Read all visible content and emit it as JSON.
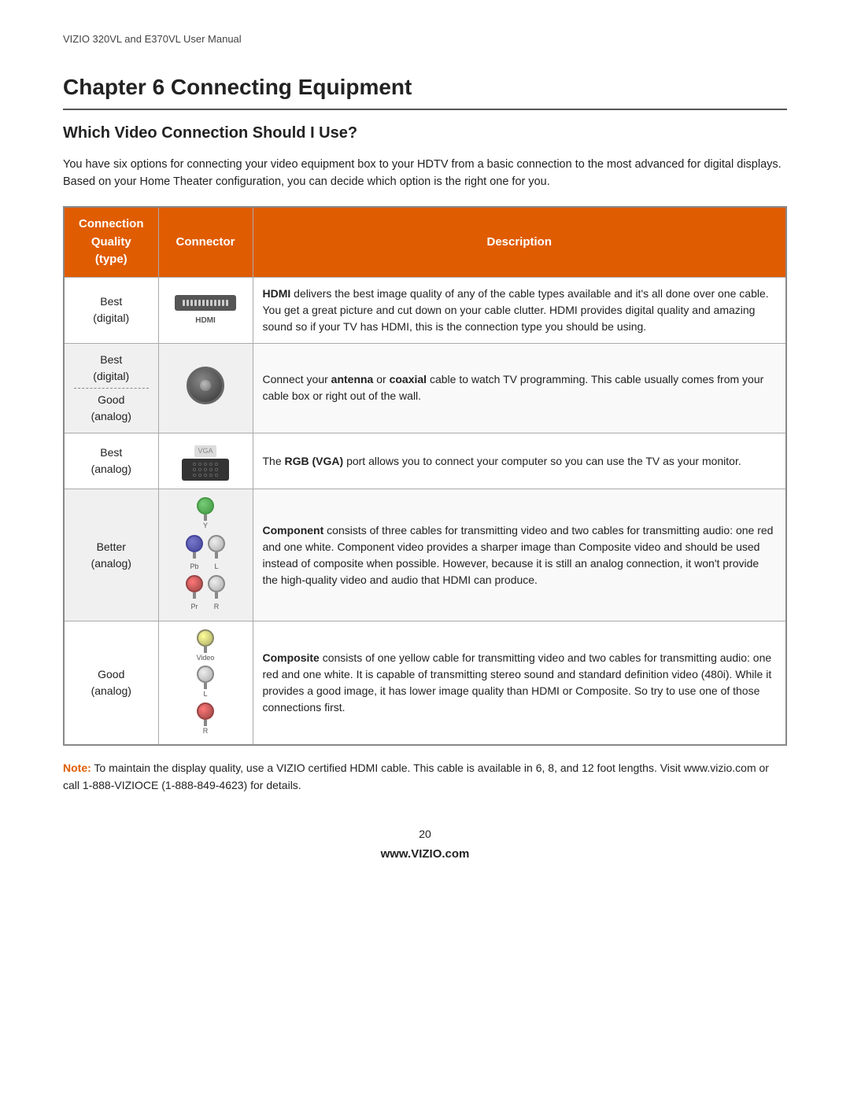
{
  "header": {
    "text": "VIZIO 320VL and E370VL User Manual"
  },
  "chapter": {
    "title": "Chapter 6 Connecting Equipment",
    "section_title": "Which Video Connection Should I Use?",
    "intro": "You have six options for connecting your video equipment box to your HDTV from a basic connection to the most advanced for digital displays. Based on your Home Theater configuration, you can decide which option is the right one for you."
  },
  "table": {
    "headers": {
      "quality": "Connection Quality (type)",
      "connector": "Connector",
      "description": "Description"
    },
    "rows": [
      {
        "quality": "Best\n(digital)",
        "connector_type": "hdmi",
        "description": "HDMI delivers the best image quality of any of the cable types available and it’s all done over one cable. You get a great picture and cut down on your cable clutter. HDMI provides digital quality and amazing sound so if your TV has HDMI, this is the connection type you should be using.",
        "description_bold": "HDMI"
      },
      {
        "quality_line1": "Best",
        "quality_line2": "(digital)",
        "quality_line3": "Good",
        "quality_line4": "(analog)",
        "connector_type": "coax",
        "description": "Connect your antenna or coaxial cable to watch TV programming. This cable usually comes from your cable box or right out of the wall.",
        "description_bold1": "antenna",
        "description_bold2": "coaxial"
      },
      {
        "quality": "Best\n(analog)",
        "connector_type": "vga",
        "description": "The RGB (VGA) port allows you to connect your computer so you can use the TV as your monitor.",
        "description_bold": "RGB (VGA)"
      },
      {
        "quality": "Better\n(analog)",
        "connector_type": "component",
        "description": "Component consists of three cables for transmitting video and two cables for transmitting audio: one red and one white. Component video provides a sharper image than Composite video and should be used instead of composite when possible. However, because it is still an analog connection, it won’t provide the high-quality video and audio that HDMI can produce.",
        "description_bold": "Component"
      },
      {
        "quality": "Good\n(analog)",
        "connector_type": "composite",
        "description": "Composite consists of one yellow cable for transmitting video and two cables for transmitting audio: one red and one white. It is capable of transmitting stereo sound and standard definition video (480i). While it provides a good image, it has lower image quality than HDMI or Composite. So try to use one of those connections first.",
        "description_bold": "Composite"
      }
    ]
  },
  "note": {
    "label": "Note:",
    "text": " To maintain the display quality, use a VIZIO certified HDMI cable. This cable is available in 6, 8, and 12 foot lengths. Visit www.vizio.com or call 1-888-VIZIOCE (1-888-849-4623) for details."
  },
  "footer": {
    "page_number": "20",
    "site": "www.VIZIO.com"
  }
}
